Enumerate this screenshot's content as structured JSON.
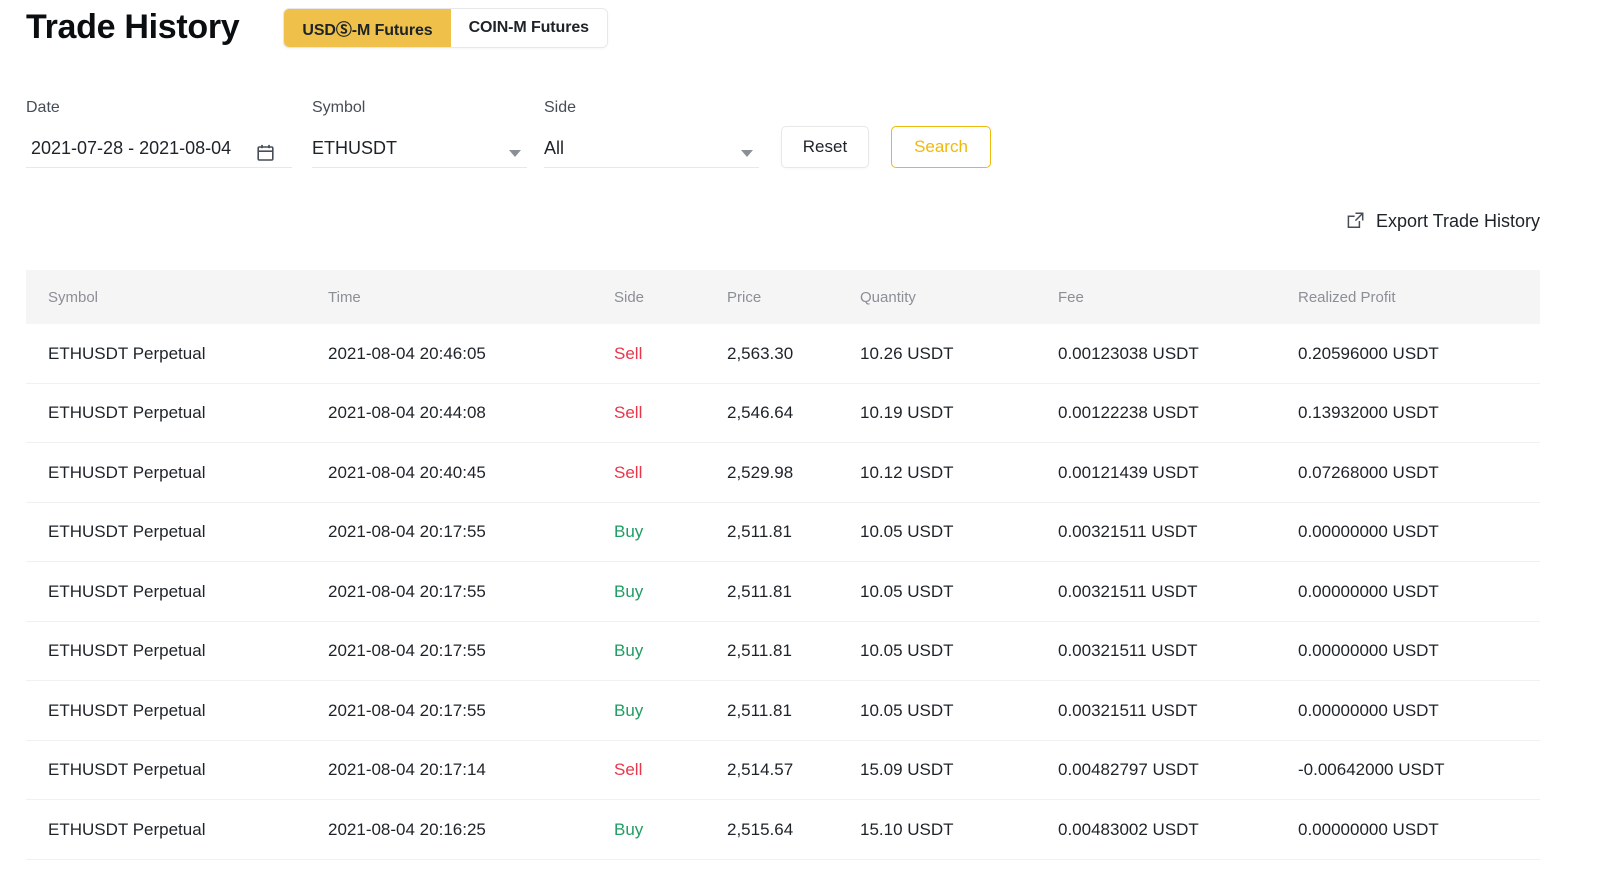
{
  "header": {
    "title": "Trade History",
    "tabs": [
      {
        "label": "USDⓈ-M Futures",
        "active": true
      },
      {
        "label": "COIN-M Futures",
        "active": false
      }
    ]
  },
  "filters": {
    "date": {
      "label": "Date",
      "value": "2021-07-28 - 2021-08-04",
      "icon": "calendar-icon"
    },
    "symbol": {
      "label": "Symbol",
      "value": "ETHUSDT",
      "icon": "chevron-down-icon"
    },
    "side": {
      "label": "Side",
      "value": "All",
      "icon": "chevron-down-icon"
    },
    "reset_label": "Reset",
    "search_label": "Search"
  },
  "export": {
    "label": "Export Trade History",
    "icon": "external-link-icon"
  },
  "table": {
    "columns": [
      "Symbol",
      "Time",
      "Side",
      "Price",
      "Quantity",
      "Fee",
      "Realized Profit"
    ],
    "rows": [
      {
        "symbol": "ETHUSDT Perpetual",
        "time": "2021-08-04 20:46:05",
        "side": "Sell",
        "price": "2,563.30",
        "quantity": "10.26 USDT",
        "fee": "0.00123038 USDT",
        "profit": "0.20596000 USDT"
      },
      {
        "symbol": "ETHUSDT Perpetual",
        "time": "2021-08-04 20:44:08",
        "side": "Sell",
        "price": "2,546.64",
        "quantity": "10.19 USDT",
        "fee": "0.00122238 USDT",
        "profit": "0.13932000 USDT"
      },
      {
        "symbol": "ETHUSDT Perpetual",
        "time": "2021-08-04 20:40:45",
        "side": "Sell",
        "price": "2,529.98",
        "quantity": "10.12 USDT",
        "fee": "0.00121439 USDT",
        "profit": "0.07268000 USDT"
      },
      {
        "symbol": "ETHUSDT Perpetual",
        "time": "2021-08-04 20:17:55",
        "side": "Buy",
        "price": "2,511.81",
        "quantity": "10.05 USDT",
        "fee": "0.00321511 USDT",
        "profit": "0.00000000 USDT"
      },
      {
        "symbol": "ETHUSDT Perpetual",
        "time": "2021-08-04 20:17:55",
        "side": "Buy",
        "price": "2,511.81",
        "quantity": "10.05 USDT",
        "fee": "0.00321511 USDT",
        "profit": "0.00000000 USDT"
      },
      {
        "symbol": "ETHUSDT Perpetual",
        "time": "2021-08-04 20:17:55",
        "side": "Buy",
        "price": "2,511.81",
        "quantity": "10.05 USDT",
        "fee": "0.00321511 USDT",
        "profit": "0.00000000 USDT"
      },
      {
        "symbol": "ETHUSDT Perpetual",
        "time": "2021-08-04 20:17:55",
        "side": "Buy",
        "price": "2,511.81",
        "quantity": "10.05 USDT",
        "fee": "0.00321511 USDT",
        "profit": "0.00000000 USDT"
      },
      {
        "symbol": "ETHUSDT Perpetual",
        "time": "2021-08-04 20:17:14",
        "side": "Sell",
        "price": "2,514.57",
        "quantity": "15.09 USDT",
        "fee": "0.00482797 USDT",
        "profit": "-0.00642000 USDT"
      },
      {
        "symbol": "ETHUSDT Perpetual",
        "time": "2021-08-04 20:16:25",
        "side": "Buy",
        "price": "2,515.64",
        "quantity": "15.10 USDT",
        "fee": "0.00483002 USDT",
        "profit": "0.00000000 USDT"
      }
    ]
  },
  "colors": {
    "accent": "#efb90b",
    "tab_active_bg": "#efc14b",
    "sell": "#e8364a",
    "buy": "#1f9d63",
    "header_bg": "#f5f5f5",
    "text": "#1e2329",
    "muted": "#8b8f96"
  }
}
